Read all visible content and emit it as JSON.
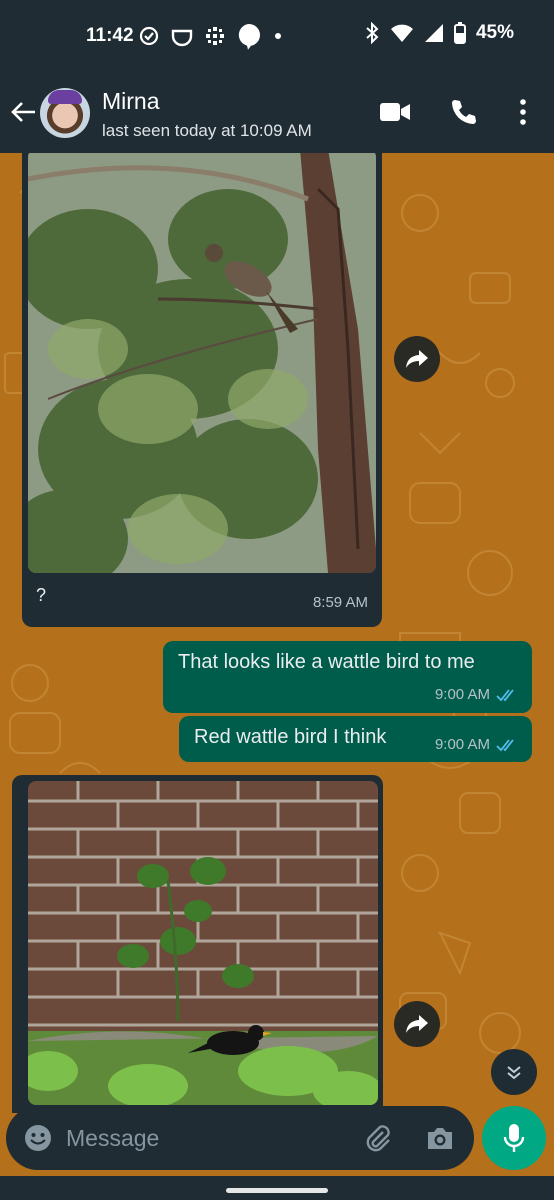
{
  "status_bar": {
    "time": "11:42",
    "battery": "45%"
  },
  "header": {
    "contact_name": "Mirna",
    "contact_status": "last seen today at 10:09 AM"
  },
  "messages": [
    {
      "direction": "incoming",
      "type": "image",
      "image_subject": "bird-in-tree-photo",
      "caption": "?",
      "time": "8:59 AM"
    },
    {
      "direction": "outgoing",
      "type": "text",
      "text": "That looks like a wattle bird to me",
      "time": "9:00 AM",
      "status": "read"
    },
    {
      "direction": "outgoing",
      "type": "text",
      "text": "Red wattle bird  I think",
      "time": "9:00 AM",
      "status": "read"
    },
    {
      "direction": "incoming",
      "type": "image",
      "image_subject": "blackbird-brick-wall-photo"
    }
  ],
  "composer": {
    "placeholder": "Message"
  },
  "colors": {
    "header_bg": "#1f2c34",
    "wallpaper": "#b5701b",
    "incoming_bubble": "#1f2c34",
    "outgoing_bubble": "#005c4b",
    "accent": "#00a884",
    "read_ticks": "#53bdeb"
  },
  "icons": [
    "back-arrow-icon",
    "video-call-icon",
    "voice-call-icon",
    "more-options-icon",
    "forward-icon",
    "scroll-down-icon",
    "emoji-icon",
    "attach-icon",
    "camera-icon",
    "mic-icon"
  ]
}
